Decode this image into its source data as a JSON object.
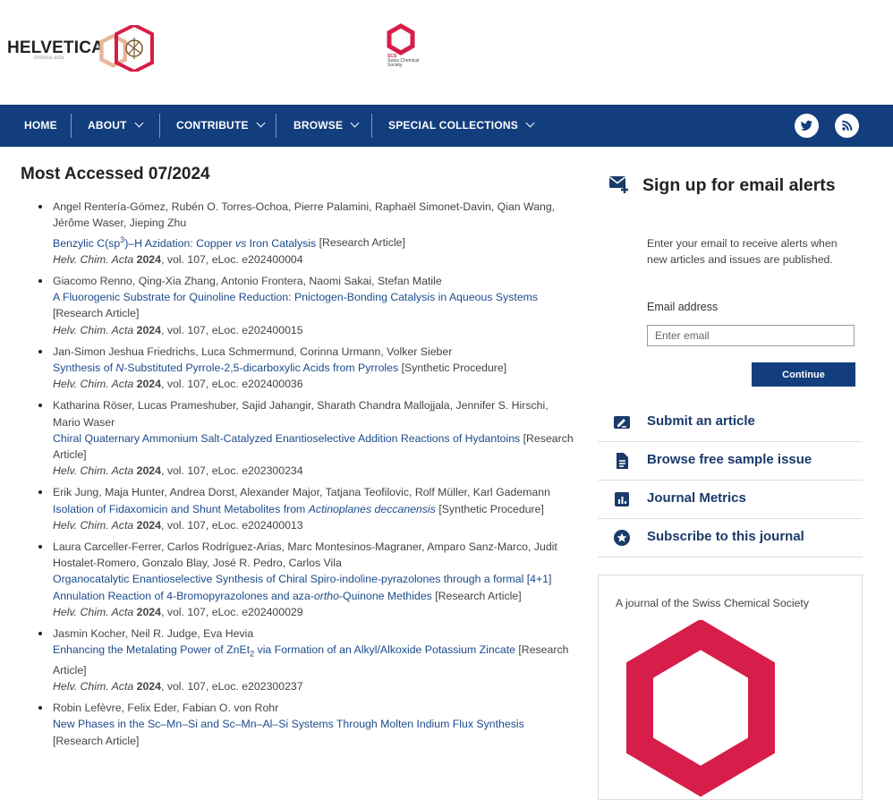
{
  "header": {
    "logo_text": "HELVETICA",
    "logo_subtext": "chimica acta",
    "society_abbr": "SCS",
    "society_name_line1": "Swiss Chemical",
    "society_name_line2": "Society"
  },
  "nav": {
    "items": [
      {
        "label": "HOME",
        "has_dropdown": false
      },
      {
        "label": "ABOUT",
        "has_dropdown": true
      },
      {
        "label": "CONTRIBUTE",
        "has_dropdown": true
      },
      {
        "label": "BROWSE",
        "has_dropdown": true
      },
      {
        "label": "SPECIAL COLLECTIONS",
        "has_dropdown": true
      }
    ],
    "social_icons": [
      "twitter-icon",
      "rss-icon"
    ]
  },
  "main": {
    "title": "Most Accessed 07/2024",
    "articles": [
      {
        "authors": "Angel Rentería-Gómez, Rubén O. Torres-Ochoa, Pierre Palamini, Raphaël Simonet-Davin, Qian Wang, Jérôme Waser, Jieping Zhu",
        "title_pre": "Benzylic C(sp",
        "title_sup": "3",
        "title_mid": ")–H Azidation: Copper ",
        "title_italic": "vs",
        "title_post": " Iron Catalysis",
        "type": "[Research Article]",
        "journal": "Helv. Chim. Acta",
        "year": "2024",
        "rest": ", vol. 107, eLoc. e202400004"
      },
      {
        "authors": "Giacomo Renno, Qing-Xia Zhang, Antonio Frontera, Naomi Sakai, Stefan Matile",
        "title": "A Fluorogenic Substrate for Quinoline Reduction: Pnictogen-Bonding Catalysis in Aqueous Systems",
        "type": "[Research Article]",
        "journal": "Helv. Chim. Acta",
        "year": "2024",
        "rest": ", vol. 107, eLoc. e202400015"
      },
      {
        "authors": "Jan-Simon Jeshua Friedrichs, Luca Schmermund, Corinna Urmann, Volker Sieber",
        "title_pre": "Synthesis of ",
        "title_italic": "N",
        "title_post": "-Substituted Pyrrole-2,5-dicarboxylic Acids from Pyrroles",
        "type": "[Synthetic Procedure]",
        "journal": "Helv. Chim. Acta",
        "year": "2024",
        "rest": ", vol. 107, eLoc. e202400036"
      },
      {
        "authors": "Katharina Röser, Lucas Prameshuber, Sajid Jahangir, Sharath Chandra Mallojjala, Jennifer S. Hirschi, Mario Waser",
        "title": "Chiral Quaternary Ammonium Salt-Catalyzed Enantioselective Addition Reactions of Hydantoins",
        "type": "[Research Article]",
        "journal": "Helv. Chim. Acta",
        "year": "2024",
        "rest": ", vol. 107, eLoc. e202300234"
      },
      {
        "authors": "Erik Jung, Maja Hunter, Andrea Dorst, Alexander Major, Tatjana Teofilovic, Rolf Müller, Karl Gademann",
        "title_pre": "Isolation of Fidaxomicin and Shunt Metabolites from ",
        "title_italic": "Actinoplanes deccanensis",
        "type": "[Synthetic Procedure]",
        "journal": "Helv. Chim. Acta",
        "year": "2024",
        "rest": ", vol. 107, eLoc. e202400013"
      },
      {
        "authors": "Laura Carceller-Ferrer, Carlos Rodríguez-Arias, Marc Montesinos-Magraner, Amparo Sanz-Marco, Judit Hostalet-Romero, Gonzalo Blay, José R. Pedro, Carlos Vila",
        "title_pre": "Organocatalytic Enantioselective Synthesis of Chiral Spiro-indoline-pyrazolones through a formal [4+1] Annulation Reaction of 4-Bromopyrazolones and aza-",
        "title_italic": "ortho",
        "title_post": "-Quinone Methides",
        "type": "[Research Article]",
        "journal": "Helv. Chim. Acta",
        "year": "2024",
        "rest": ", vol. 107, eLoc. e202400029"
      },
      {
        "authors": "Jasmin Kocher, Neil R. Judge, Eva Hevia",
        "title_pre": "Enhancing the Metalating Power of ZnEt",
        "title_sub": "2",
        "title_post": " via Formation of an Alkyl/Alkoxide Potassium Zincate",
        "type": "[Research Article]",
        "journal": "Helv. Chim. Acta",
        "year": "2024",
        "rest": ", vol. 107, eLoc. e202300237"
      },
      {
        "authors": "Robin Lefèvre, Felix Eder, Fabian O. von Rohr",
        "title": "New Phases in the Sc–Mn–Si and Sc–Mn–Al–Si Systems Through Molten Indium Flux Synthesis",
        "type": "[Research Article]"
      }
    ]
  },
  "sidebar": {
    "signup_title": "Sign up for email alerts",
    "signup_text": "Enter your email to receive alerts when new articles and issues are published.",
    "email_label": "Email address",
    "email_placeholder": "Enter email",
    "continue_label": "Continue",
    "links": [
      {
        "label": "Submit an article",
        "icon": "edit-icon"
      },
      {
        "label": "Browse free sample issue",
        "icon": "document-icon"
      },
      {
        "label": "Journal Metrics",
        "icon": "chart-icon"
      },
      {
        "label": "Subscribe to this journal",
        "icon": "star-icon"
      }
    ],
    "journal_text": "A journal of the Swiss Chemical Society"
  },
  "colors": {
    "nav_bg": "#123e7e",
    "link": "#1c4b8c",
    "brand_red": "#d71d4a"
  }
}
